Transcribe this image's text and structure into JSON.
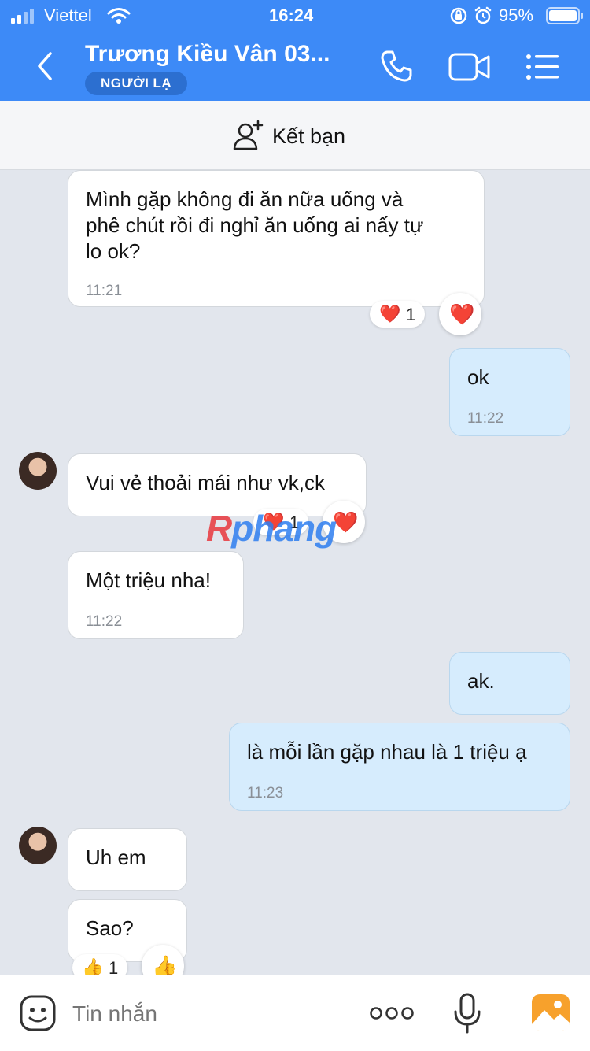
{
  "status_bar": {
    "carrier": "Viettel",
    "time": "16:24",
    "battery": "95%"
  },
  "header": {
    "title": "Trương Kiều Vân 03...",
    "badge": "NGƯỜI LẠ"
  },
  "friend_bar": {
    "label": "Kết bạn"
  },
  "messages": [
    {
      "text1": "Mình gặp không đi ăn nữa uống và",
      "text2": "phê chút rồi đi nghỉ ăn uống ai nấy tự",
      "text3": "lo ok?",
      "time": "11:21",
      "reaction": "❤️",
      "reaction_count": "1"
    },
    {
      "text": "ok",
      "time": "11:22"
    },
    {
      "text": "Vui vẻ thoải mái như vk,ck",
      "reaction": "❤️",
      "reaction_count": "1"
    },
    {
      "text": "Một triệu nha!",
      "time": "11:22"
    },
    {
      "text": "ak."
    },
    {
      "text": "là mỗi lần gặp nhau là 1 triệu ạ",
      "time": "11:23"
    },
    {
      "text": "Uh em"
    },
    {
      "text": "Sao?",
      "reaction": "👍",
      "reaction_count": "1"
    }
  ],
  "watermark": {
    "part1": "R",
    "part2": "phang"
  },
  "input_bar": {
    "placeholder": "Tin nhắn"
  },
  "colors": {
    "header_bg": "#3d8af7",
    "outgoing_bubble": "#d6ecfd",
    "incoming_bubble": "#ffffff",
    "chat_bg": "#e2e6ed"
  }
}
